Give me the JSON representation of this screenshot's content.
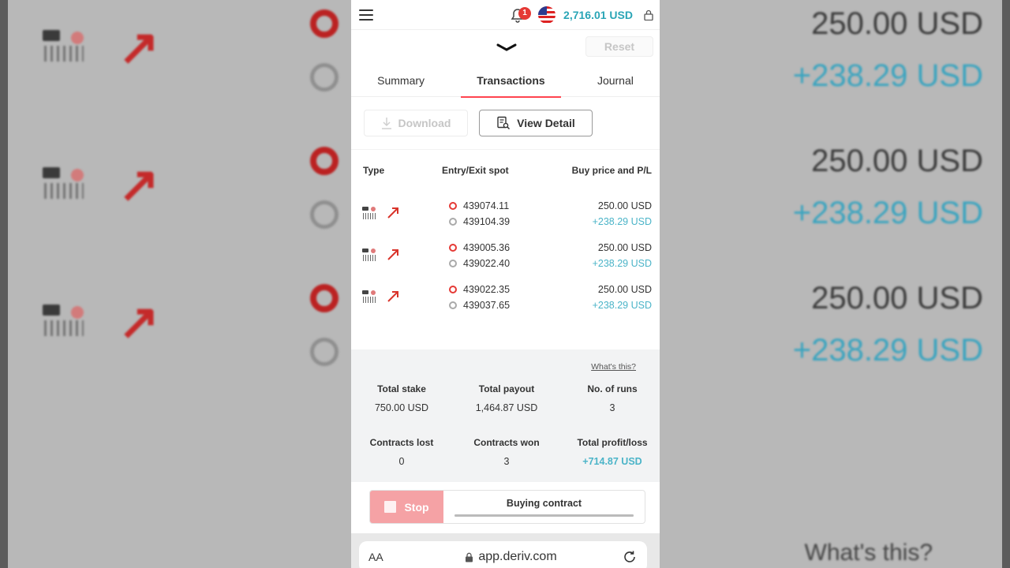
{
  "header": {
    "notification_count": "1",
    "balance": "2,716.01 USD"
  },
  "controls": {
    "reset_label": "Reset"
  },
  "tabs": [
    {
      "label": "Summary",
      "active": false
    },
    {
      "label": "Transactions",
      "active": true
    },
    {
      "label": "Journal",
      "active": false
    }
  ],
  "actions": {
    "download_label": "Download",
    "view_detail_label": "View Detail"
  },
  "table": {
    "columns": [
      "Type",
      "Entry/Exit spot",
      "Buy price and P/L"
    ],
    "rows": [
      {
        "entry": "439074.11",
        "exit": "439104.39",
        "buy_price": "250.00 USD",
        "pl": "+238.29 USD"
      },
      {
        "entry": "439005.36",
        "exit": "439022.40",
        "buy_price": "250.00 USD",
        "pl": "+238.29 USD"
      },
      {
        "entry": "439022.35",
        "exit": "439037.65",
        "buy_price": "250.00 USD",
        "pl": "+238.29 USD"
      }
    ]
  },
  "summary": {
    "whats_this": "What's this?",
    "total_stake_label": "Total stake",
    "total_stake": "750.00 USD",
    "total_payout_label": "Total payout",
    "total_payout": "1,464.87 USD",
    "runs_label": "No. of runs",
    "runs": "3",
    "lost_label": "Contracts lost",
    "lost": "0",
    "won_label": "Contracts won",
    "won": "3",
    "pl_label": "Total profit/loss",
    "pl": "+714.87 USD"
  },
  "runbar": {
    "stop_label": "Stop",
    "status": "Buying contract",
    "progress": 1.0
  },
  "browser": {
    "aa_label": "AA",
    "url": "app.deriv.com"
  },
  "backdrop": {
    "price": "250.00 USD",
    "pl": "+238.29 USD",
    "whats_this": "What's this?"
  },
  "colors": {
    "accent_red": "#ff444f",
    "profit_teal": "#4bb4c8",
    "balance_teal": "#2aa5b6"
  }
}
